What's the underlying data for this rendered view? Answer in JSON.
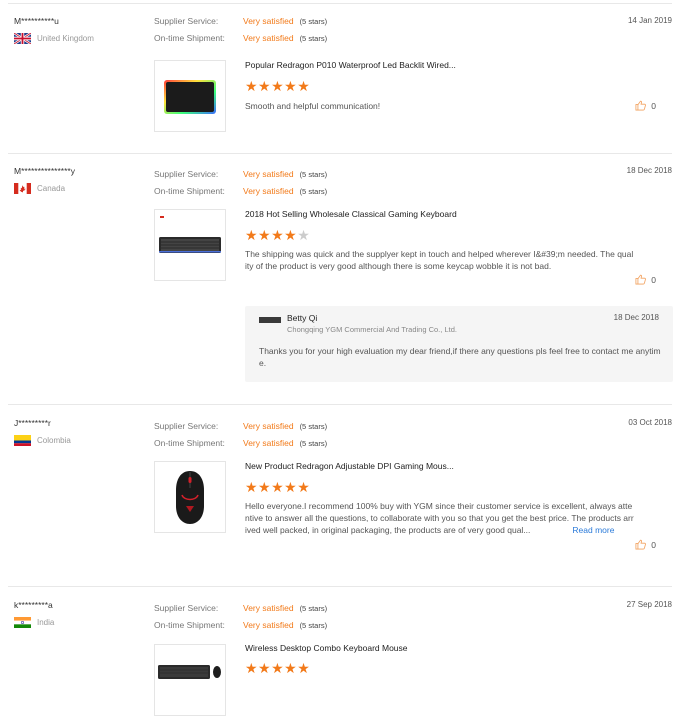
{
  "labels": {
    "supplier_service": "Supplier Service:",
    "on_time_shipment": "On-time Shipment:",
    "rating_value": "Very satisfied",
    "rating_stars": "(5 stars)"
  },
  "colors": {
    "accent": "#f27a1a",
    "link": "#2a7ad9"
  },
  "reviews": [
    {
      "user": "M**********u",
      "country": "United Kingdom",
      "flag_icon": "uk-flag-icon",
      "date": "14 Jan 2019",
      "product_title": "Popular Redragon P010 Waterproof Led Backlit Wired...",
      "product_image_icon": "mousepad-image",
      "stars": "★★★★★",
      "stars_off": "",
      "rating": 5,
      "comment": "Smooth and helpful communication!",
      "likes": "0"
    },
    {
      "user": "M***************y",
      "country": "Canada",
      "flag_icon": "canada-flag-icon",
      "date": "18 Dec 2018",
      "product_title": "2018 Hot Selling Wholesale Classical Gaming Keyboard",
      "product_image_icon": "keyboard-image",
      "stars": "★★★★",
      "stars_off": "★",
      "rating": 4,
      "comment": "The shipping was quick and the supplyer kept in touch and helped wherever I&#39;m needed. The quality of the product is very good although there is some keycap wobble it is not bad.",
      "likes": "0",
      "reply": {
        "name": "Betty Qi",
        "company": "Chongqing YGM Commercial And Trading Co., Ltd.",
        "date": "18 Dec 2018",
        "text": "Thanks you for your high evaluation my dear friend,if there any questions pls feel free to contact me anytime."
      }
    },
    {
      "user": "J*********r",
      "country": "Colombia",
      "flag_icon": "colombia-flag-icon",
      "date": "03 Oct 2018",
      "product_title": "New Product Redragon Adjustable DPI Gaming Mous...",
      "product_image_icon": "gaming-mouse-image",
      "stars": "★★★★★",
      "stars_off": "",
      "rating": 5,
      "comment": "Hello everyone.I recommend 100% buy with YGM since their customer service is excellent, always attentive to answer all the questions, to collaborate with you so that you get the best price. The products arrived well packed, in original packaging, the products are of very good qual...",
      "read_more": "Read more",
      "likes": "0"
    },
    {
      "user": "k*********a",
      "country": "India",
      "flag_icon": "india-flag-icon",
      "date": "27 Sep 2018",
      "product_title": "Wireless Desktop Combo Keyboard Mouse",
      "product_image_icon": "keyboard-combo-image",
      "stars": "★★★★★",
      "stars_off": "",
      "rating": 5
    }
  ]
}
